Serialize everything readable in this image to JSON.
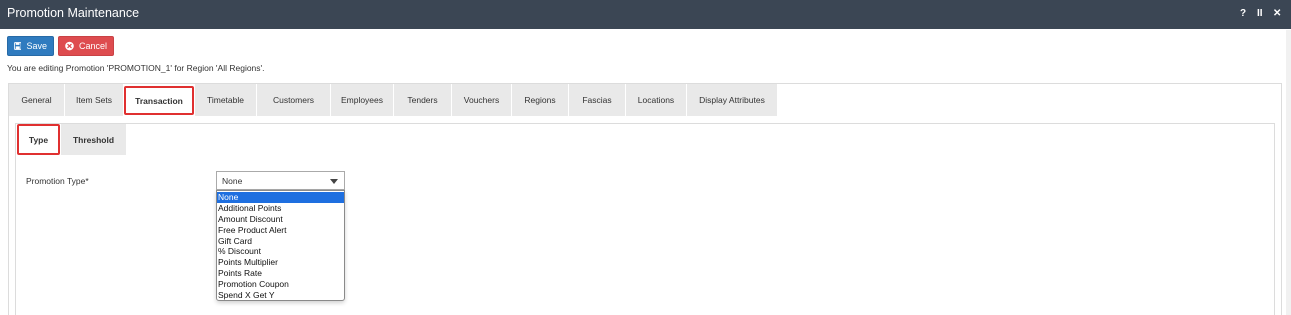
{
  "window": {
    "title": "Promotion Maintenance",
    "controls": {
      "help": "?",
      "pause": "II",
      "close": "✕"
    }
  },
  "toolbar": {
    "save_label": "Save",
    "cancel_label": "Cancel"
  },
  "editing_message": "You are editing Promotion 'PROMOTION_1' for Region 'All Regions'.",
  "tabs": [
    {
      "label": "General",
      "active": false
    },
    {
      "label": "Item Sets",
      "active": false
    },
    {
      "label": "Transaction",
      "active": true
    },
    {
      "label": "Timetable",
      "active": false
    },
    {
      "label": "Customers",
      "active": false
    },
    {
      "label": "Employees",
      "active": false
    },
    {
      "label": "Tenders",
      "active": false
    },
    {
      "label": "Vouchers",
      "active": false
    },
    {
      "label": "Regions",
      "active": false
    },
    {
      "label": "Fascias",
      "active": false
    },
    {
      "label": "Locations",
      "active": false
    },
    {
      "label": "Display Attributes",
      "active": false
    }
  ],
  "subtabs": [
    {
      "label": "Type",
      "active": true
    },
    {
      "label": "Threshold",
      "active": false
    }
  ],
  "promotion_type": {
    "label": "Promotion Type*",
    "selected": "None",
    "options": [
      "None",
      "Additional Points",
      "Amount Discount",
      "Free Product Alert",
      "Gift Card",
      "% Discount",
      "Points Multiplier",
      "Points Rate",
      "Promotion Coupon",
      "Spend X Get Y"
    ]
  },
  "colors": {
    "titlebar": "#3b4654",
    "save": "#2f7bbf",
    "cancel": "#de4c4f",
    "highlight": "#e03030",
    "selected_option": "#1e6fe0"
  }
}
